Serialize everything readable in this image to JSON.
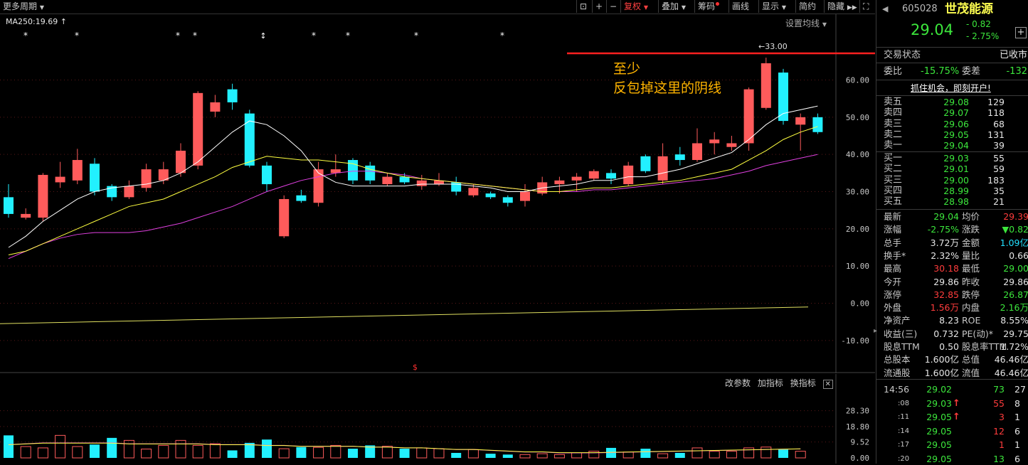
{
  "toolbar": {
    "period": "更多周期",
    "icons": [
      "lock-icon",
      "plus-icon",
      "minus-icon"
    ],
    "fuquan": "复权",
    "overlay": "叠加",
    "chips": "筹码",
    "draw": "画线",
    "display": "显示",
    "simple": "简约",
    "hide": "隐藏"
  },
  "main": {
    "ma_label": "MA250:19.69",
    "settings": "设置均线",
    "annotation_line1": "至少",
    "annotation_line2": "反包掉这里的阴线",
    "peak_label": "33.00",
    "y_ticks": [
      "60.00",
      "50.00",
      "40.00",
      "30.00",
      "20.00",
      "10.00",
      "0.00",
      "-10.00"
    ],
    "dollar": "$"
  },
  "volume": {
    "buttons": [
      "改参数",
      "加指标",
      "换指标"
    ],
    "y_ticks": [
      "28.30",
      "18.80",
      "9.52",
      "0.00"
    ]
  },
  "quote": {
    "code": "605028",
    "name": "世茂能源",
    "price": "29.04",
    "change": "- 0.82",
    "change_pct": "- 2.75%",
    "status_label": "交易状态",
    "status_value": "已收市",
    "weibi_label": "委比",
    "weibi_value": "-15.75%",
    "weicha_label": "委差",
    "weicha_value": "-132",
    "banner": "抓住机会，即刻开户!"
  },
  "asks": [
    {
      "label": "卖五",
      "price": "29.08",
      "vol": "129"
    },
    {
      "label": "卖四",
      "price": "29.07",
      "vol": "118"
    },
    {
      "label": "卖三",
      "price": "29.06",
      "vol": "68"
    },
    {
      "label": "卖二",
      "price": "29.05",
      "vol": "131"
    },
    {
      "label": "卖一",
      "price": "29.04",
      "vol": "39"
    }
  ],
  "bids": [
    {
      "label": "买一",
      "price": "29.03",
      "vol": "55"
    },
    {
      "label": "买二",
      "price": "29.01",
      "vol": "59"
    },
    {
      "label": "买三",
      "price": "29.00",
      "vol": "183"
    },
    {
      "label": "买四",
      "price": "28.99",
      "vol": "35"
    },
    {
      "label": "买五",
      "price": "28.98",
      "vol": "21"
    }
  ],
  "stats": [
    {
      "l1": "最新",
      "v1": "29.04",
      "c1": "green",
      "l2": "均价",
      "v2": "29.39",
      "c2": "red"
    },
    {
      "l1": "涨幅",
      "v1": "-2.75%",
      "c1": "green",
      "l2": "涨跌",
      "v2": "▼0.82",
      "c2": "green"
    },
    {
      "l1": "总手",
      "v1": "3.72万",
      "c1": "white",
      "l2": "金额",
      "v2": "1.09亿",
      "c2": "cyan"
    },
    {
      "l1": "换手*",
      "v1": "2.32%",
      "c1": "white",
      "l2": "量比",
      "v2": "0.66",
      "c2": "white"
    },
    {
      "l1": "最高",
      "v1": "30.18",
      "c1": "red",
      "l2": "最低",
      "v2": "29.00",
      "c2": "green"
    },
    {
      "l1": "今开",
      "v1": "29.86",
      "c1": "white",
      "l2": "昨收",
      "v2": "29.86",
      "c2": "white"
    },
    {
      "l1": "涨停",
      "v1": "32.85",
      "c1": "red",
      "l2": "跌停",
      "v2": "26.87",
      "c2": "green"
    },
    {
      "l1": "外盘",
      "v1": "1.56万",
      "c1": "red",
      "l2": "内盘",
      "v2": "2.16万",
      "c2": "green"
    },
    {
      "l1": "净资产",
      "v1": "8.23",
      "c1": "white",
      "l2": "ROE",
      "v2": "8.55%",
      "c2": "white"
    },
    {
      "l1": "收益(三)",
      "v1": "0.732",
      "c1": "white",
      "l2": "PE(动)*",
      "v2": "29.75",
      "c2": "white"
    },
    {
      "l1": "股息TTM",
      "v1": "0.50",
      "c1": "white",
      "l2": "股息率TTM",
      "v2": "1.72%",
      "c2": "white"
    },
    {
      "l1": "总股本",
      "v1": "1.600亿",
      "c1": "white",
      "l2": "总值",
      "v2": "46.46亿",
      "c2": "white"
    },
    {
      "l1": "流通股",
      "v1": "1.600亿",
      "c1": "white",
      "l2": "流值",
      "v2": "46.46亿",
      "c2": "white"
    }
  ],
  "ticks": [
    {
      "time": "14:56",
      "price": "29.02",
      "arrow": "",
      "vol": "73",
      "vc": "green",
      "n": "27"
    },
    {
      "time": ":08",
      "price": "29.03",
      "arrow": "↑",
      "vol": "55",
      "vc": "red",
      "n": "8"
    },
    {
      "time": ":11",
      "price": "29.05",
      "arrow": "↑",
      "vol": "3",
      "vc": "red",
      "n": "1"
    },
    {
      "time": ":14",
      "price": "29.05",
      "arrow": "",
      "vol": "12",
      "vc": "red",
      "n": "6"
    },
    {
      "time": ":17",
      "price": "29.05",
      "arrow": "",
      "vol": "1",
      "vc": "red",
      "n": "1"
    },
    {
      "time": ":20",
      "price": "29.05",
      "arrow": "",
      "vol": "13",
      "vc": "green",
      "n": "6"
    }
  ],
  "chart_data": {
    "type": "candlestick",
    "y_range": [
      -10,
      60
    ],
    "candles": [
      {
        "o": 28.5,
        "c": 24,
        "h": 32,
        "l": 23
      },
      {
        "o": 23,
        "c": 24,
        "h": 25.5,
        "l": 22.5
      },
      {
        "o": 23,
        "c": 34.5,
        "h": 35,
        "l": 22
      },
      {
        "o": 32.5,
        "c": 34,
        "h": 38,
        "l": 31
      },
      {
        "o": 33,
        "c": 38.5,
        "h": 41.5,
        "l": 32
      },
      {
        "o": 37.5,
        "c": 30,
        "h": 39,
        "l": 29
      },
      {
        "o": 31.5,
        "c": 28.5,
        "h": 32,
        "l": 27.5
      },
      {
        "o": 28.5,
        "c": 31.5,
        "h": 33,
        "l": 28
      },
      {
        "o": 31,
        "c": 36,
        "h": 37.5,
        "l": 30
      },
      {
        "o": 33,
        "c": 36,
        "h": 38,
        "l": 32
      },
      {
        "o": 35,
        "c": 41,
        "h": 43,
        "l": 34
      },
      {
        "o": 37,
        "c": 56.5,
        "h": 57,
        "l": 36
      },
      {
        "o": 51.5,
        "c": 54,
        "h": 56,
        "l": 50
      },
      {
        "o": 57.5,
        "c": 54,
        "h": 59,
        "l": 52
      },
      {
        "o": 51,
        "c": 37,
        "h": 52,
        "l": 36.5
      },
      {
        "o": 37,
        "c": 32,
        "h": 38,
        "l": 30
      },
      {
        "o": 18,
        "c": 28,
        "h": 29,
        "l": 17.5
      },
      {
        "o": 29,
        "c": 27.5,
        "h": 30.5,
        "l": 27
      },
      {
        "o": 27,
        "c": 36,
        "h": 38,
        "l": 26
      },
      {
        "o": 35,
        "c": 36,
        "h": 40,
        "l": 34
      },
      {
        "o": 38.5,
        "c": 33,
        "h": 39,
        "l": 32
      },
      {
        "o": 37,
        "c": 33,
        "h": 38,
        "l": 32
      },
      {
        "o": 32,
        "c": 34,
        "h": 35,
        "l": 31.5
      },
      {
        "o": 34,
        "c": 32.5,
        "h": 35,
        "l": 32
      },
      {
        "o": 31.5,
        "c": 33,
        "h": 34.5,
        "l": 30.5
      },
      {
        "o": 32,
        "c": 33,
        "h": 35,
        "l": 31.5
      },
      {
        "o": 32.5,
        "c": 30,
        "h": 34,
        "l": 29
      },
      {
        "o": 29,
        "c": 31,
        "h": 32,
        "l": 28.5
      },
      {
        "o": 29.5,
        "c": 28.5,
        "h": 30,
        "l": 28
      },
      {
        "o": 28.5,
        "c": 27,
        "h": 29,
        "l": 26
      },
      {
        "o": 27.5,
        "c": 30,
        "h": 32,
        "l": 26
      },
      {
        "o": 29.5,
        "c": 32.5,
        "h": 34,
        "l": 29
      },
      {
        "o": 32,
        "c": 33,
        "h": 34,
        "l": 29.5
      },
      {
        "o": 33,
        "c": 34,
        "h": 35,
        "l": 30
      },
      {
        "o": 33.5,
        "c": 35.5,
        "h": 36,
        "l": 33
      },
      {
        "o": 35,
        "c": 33.5,
        "h": 36,
        "l": 32
      },
      {
        "o": 32,
        "c": 37,
        "h": 38,
        "l": 31.5
      },
      {
        "o": 39.5,
        "c": 35.5,
        "h": 40,
        "l": 35
      },
      {
        "o": 33,
        "c": 39.5,
        "h": 43,
        "l": 32
      },
      {
        "o": 40,
        "c": 38.5,
        "h": 42,
        "l": 37
      },
      {
        "o": 38.5,
        "c": 43,
        "h": 47,
        "l": 38
      },
      {
        "o": 43,
        "c": 44,
        "h": 46,
        "l": 40
      },
      {
        "o": 42,
        "c": 43,
        "h": 45,
        "l": 41
      },
      {
        "o": 43,
        "c": 57.5,
        "h": 58,
        "l": 41
      },
      {
        "o": 52.5,
        "c": 64.5,
        "h": 66,
        "l": 52
      },
      {
        "o": 62,
        "c": 49,
        "h": 63,
        "l": 48
      },
      {
        "o": 48,
        "c": 50,
        "h": 51,
        "l": 41
      },
      {
        "o": 50,
        "c": 46,
        "h": 51,
        "l": 45.5
      }
    ],
    "ma5": [
      15,
      18,
      22,
      25,
      28,
      30,
      31,
      31.5,
      32,
      33,
      35,
      38,
      42,
      46,
      49,
      48,
      45,
      41,
      35,
      32.5,
      31.5,
      31.5,
      31.5,
      31.5,
      32,
      32,
      32,
      31.5,
      31,
      30,
      30,
      31,
      31.5,
      32,
      33,
      33,
      34,
      34,
      35,
      36,
      37.5,
      39,
      40.5,
      44,
      48,
      51,
      52,
      53
    ],
    "ma10": [
      13,
      14,
      16,
      18,
      20,
      22,
      24,
      26,
      27,
      28,
      30,
      32,
      34,
      36.5,
      38,
      39.5,
      39,
      38.5,
      38.5,
      38,
      37.5,
      36,
      35,
      34,
      33.5,
      33,
      32.5,
      32,
      31.5,
      31,
      30.5,
      30,
      30,
      30.5,
      31,
      31,
      31.5,
      32,
      32.5,
      33,
      34,
      35,
      36,
      38.5,
      41,
      44,
      46,
      47.5
    ],
    "ma30": [
      12,
      14,
      16,
      17.5,
      18.5,
      19,
      19,
      19,
      19.5,
      20.5,
      21.5,
      23,
      24.5,
      26,
      28,
      30,
      31.5,
      33,
      34,
      35,
      35.5,
      35.5,
      35,
      34.5,
      33.5,
      33,
      32.5,
      32,
      31.5,
      31,
      30.5,
      30,
      30,
      30,
      30.5,
      30.5,
      31,
      31.5,
      32,
      32.5,
      33,
      33.5,
      34.5,
      35.5,
      37,
      38,
      39,
      40
    ],
    "ma250_line": {
      "x": [
        0,
        1136
      ],
      "y": [
        -5.5,
        -1
      ]
    },
    "volume": [
      13.5,
      6.8,
      6,
      13.5,
      6.8,
      8,
      12,
      10.5,
      5.3,
      7.5,
      10.5,
      7.5,
      8.5,
      4.5,
      9,
      11,
      5.5,
      6.5,
      6.3,
      7.5,
      5.5,
      7.5,
      7,
      5.5,
      6,
      5.5,
      3,
      5,
      2.5,
      2,
      2,
      2.5,
      2,
      3,
      4,
      6,
      3.5,
      5.5,
      2.5,
      3,
      6,
      4,
      4,
      6,
      6.5,
      5,
      4
    ],
    "vol_ma": [
      8,
      8.5,
      9,
      9,
      9,
      9,
      9,
      8.5,
      8.5,
      8.5,
      8.5,
      8.5,
      8,
      8,
      8,
      7.5,
      7.5,
      7,
      7,
      7,
      7,
      6.5,
      6.5,
      6,
      6,
      5.5,
      5,
      5,
      4.5,
      4,
      3.5,
      3.5,
      3,
      3,
      3,
      3.2,
      3.4,
      3.6,
      3.8,
      4,
      4.2,
      4.4,
      4.6,
      4.8,
      5,
      5.2,
      5.4
    ]
  }
}
